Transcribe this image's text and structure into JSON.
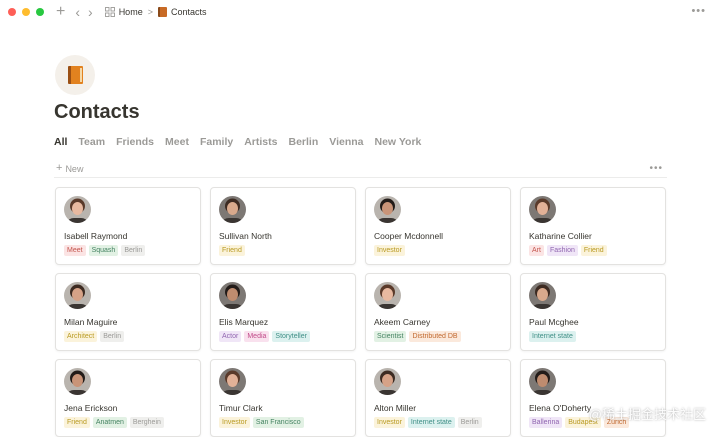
{
  "breadcrumb": {
    "home": "Home",
    "sep": ">",
    "current": "Contacts"
  },
  "page": {
    "title": "Contacts"
  },
  "tabs": [
    "All",
    "Team",
    "Friends",
    "Meet",
    "Family",
    "Artists",
    "Berlin",
    "Vienna",
    "New York"
  ],
  "toolbar": {
    "new_label": "New"
  },
  "tag_colors": {
    "red": {
      "bg": "#fbe4e4",
      "fg": "#c4554d"
    },
    "green": {
      "bg": "#e2f1e4",
      "fg": "#448361"
    },
    "gray": {
      "bg": "#efefed",
      "fg": "#9b9a97"
    },
    "yellow": {
      "bg": "#fbf3db",
      "fg": "#b99a21"
    },
    "purple": {
      "bg": "#f0e6f7",
      "fg": "#9065b0"
    },
    "pink": {
      "bg": "#f9e1ee",
      "fg": "#c14c8a"
    },
    "blue": {
      "bg": "#e0ecf8",
      "fg": "#487ca5"
    },
    "orange": {
      "bg": "#fbe9dc",
      "fg": "#c1682e"
    },
    "teal": {
      "bg": "#dcf1ef",
      "fg": "#3f8f86"
    }
  },
  "contacts": [
    {
      "name": "Isabell Raymond",
      "tags": [
        [
          "Meet",
          "red"
        ],
        [
          "Squash",
          "green"
        ],
        [
          "Berlin",
          "gray"
        ]
      ]
    },
    {
      "name": "Sullivan North",
      "tags": [
        [
          "Friend",
          "yellow"
        ]
      ]
    },
    {
      "name": "Cooper Mcdonnell",
      "tags": [
        [
          "Investor",
          "yellow"
        ]
      ]
    },
    {
      "name": "Katharine Collier",
      "tags": [
        [
          "Art",
          "red"
        ],
        [
          "Fashion",
          "purple"
        ],
        [
          "Friend",
          "yellow"
        ]
      ]
    },
    {
      "name": "Milan Maguire",
      "tags": [
        [
          "Architect",
          "yellow"
        ],
        [
          "Berlin",
          "gray"
        ]
      ]
    },
    {
      "name": "Elis Marquez",
      "tags": [
        [
          "Actor",
          "purple"
        ],
        [
          "Media",
          "pink"
        ],
        [
          "Storyteller",
          "teal"
        ]
      ]
    },
    {
      "name": "Akeem Carney",
      "tags": [
        [
          "Scientist",
          "green"
        ],
        [
          "Distributed DB",
          "orange"
        ]
      ]
    },
    {
      "name": "Paul Mcghee",
      "tags": [
        [
          "Internet state",
          "teal"
        ]
      ]
    },
    {
      "name": "Jena Erickson",
      "tags": [
        [
          "Friend",
          "yellow"
        ],
        [
          "Anatmen",
          "green"
        ],
        [
          "Berghein",
          "gray"
        ]
      ]
    },
    {
      "name": "Timur Clark",
      "tags": [
        [
          "Investor",
          "yellow"
        ],
        [
          "San Francisco",
          "green"
        ]
      ]
    },
    {
      "name": "Alton Miller",
      "tags": [
        [
          "Investor",
          "yellow"
        ],
        [
          "Internet state",
          "teal"
        ],
        [
          "Berlin",
          "gray"
        ]
      ]
    },
    {
      "name": "Elena O'Doherty",
      "tags": [
        [
          "Ballerina",
          "purple"
        ],
        [
          "Budapest",
          "yellow"
        ],
        [
          "Zurich",
          "orange"
        ]
      ]
    }
  ],
  "watermark": "@稀土掘金技术社区"
}
